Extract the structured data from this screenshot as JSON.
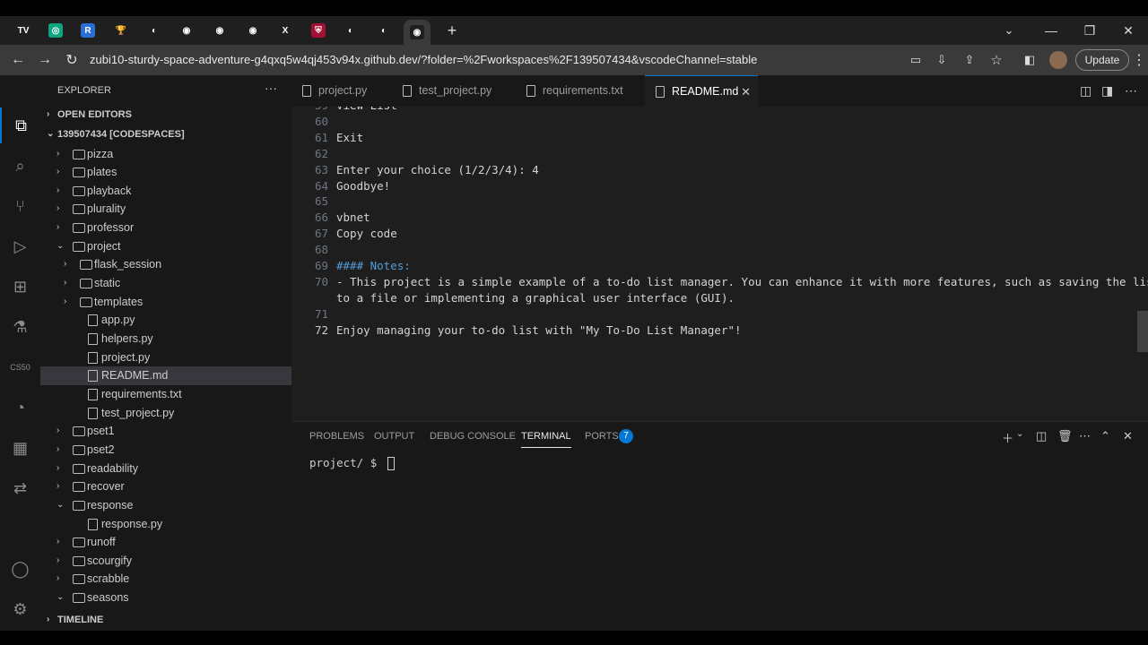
{
  "browser": {
    "url": "zubi10-sturdy-space-adventure-g4qxq5w4qj453v94x.github.dev/?folder=%2Fworkspaces%2F139507434&vscodeChannel=stable",
    "update_label": "Update",
    "new_tab": "+",
    "tabs": [
      {
        "icon": "tv-icon",
        "glyph": "TV",
        "color": "#1f1f1f"
      },
      {
        "icon": "chatgpt-icon",
        "glyph": "◎",
        "color": "#10a37f"
      },
      {
        "icon": "r-icon",
        "glyph": "R",
        "color": "#2a6fd6"
      },
      {
        "icon": "trophy-icon",
        "glyph": "🏆",
        "color": "#1f1f1f"
      },
      {
        "icon": "globe-icon",
        "glyph": "◐",
        "color": "#1f1f1f"
      },
      {
        "icon": "github-icon",
        "glyph": "◉",
        "color": "#1f1f1f"
      },
      {
        "icon": "github-icon",
        "glyph": "◉",
        "color": "#1f1f1f"
      },
      {
        "icon": "github-icon",
        "glyph": "◉",
        "color": "#1f1f1f"
      },
      {
        "icon": "x-icon",
        "glyph": "X",
        "color": "#1f1f1f"
      },
      {
        "icon": "harvard-shield-icon",
        "glyph": "⛨",
        "color": "#a41034"
      },
      {
        "icon": "globe-icon",
        "glyph": "◐",
        "color": "#1f1f1f"
      },
      {
        "icon": "globe-icon",
        "glyph": "◐",
        "color": "#1f1f1f"
      },
      {
        "icon": "github-icon",
        "glyph": "◉",
        "color": "#1f1f1f"
      }
    ]
  },
  "explorer": {
    "title": "EXPLORER",
    "more": "···",
    "open_editors": "OPEN EDITORS",
    "workspace": "139507434 [CODESPACES]",
    "timeline": "TIMELINE",
    "tree": [
      {
        "label": "pizza",
        "type": "folder",
        "depth": 0,
        "open": false
      },
      {
        "label": "plates",
        "type": "folder",
        "depth": 0,
        "open": false
      },
      {
        "label": "playback",
        "type": "folder",
        "depth": 0,
        "open": false
      },
      {
        "label": "plurality",
        "type": "folder",
        "depth": 0,
        "open": false
      },
      {
        "label": "professor",
        "type": "folder",
        "depth": 0,
        "open": false
      },
      {
        "label": "project",
        "type": "folder",
        "depth": 0,
        "open": true
      },
      {
        "label": "flask_session",
        "type": "folder",
        "depth": 1,
        "open": false
      },
      {
        "label": "static",
        "type": "folder",
        "depth": 1,
        "open": false
      },
      {
        "label": "templates",
        "type": "folder",
        "depth": 1,
        "open": false
      },
      {
        "label": "app.py",
        "type": "file",
        "depth": 1
      },
      {
        "label": "helpers.py",
        "type": "file",
        "depth": 1
      },
      {
        "label": "project.py",
        "type": "file",
        "depth": 1
      },
      {
        "label": "README.md",
        "type": "file",
        "depth": 1,
        "selected": true
      },
      {
        "label": "requirements.txt",
        "type": "file",
        "depth": 1
      },
      {
        "label": "test_project.py",
        "type": "file",
        "depth": 1
      },
      {
        "label": "pset1",
        "type": "folder",
        "depth": 0,
        "open": false
      },
      {
        "label": "pset2",
        "type": "folder",
        "depth": 0,
        "open": false
      },
      {
        "label": "readability",
        "type": "folder",
        "depth": 0,
        "open": false
      },
      {
        "label": "recover",
        "type": "folder",
        "depth": 0,
        "open": false
      },
      {
        "label": "response",
        "type": "folder",
        "depth": 0,
        "open": true
      },
      {
        "label": "response.py",
        "type": "file",
        "depth": 1
      },
      {
        "label": "runoff",
        "type": "folder",
        "depth": 0,
        "open": false
      },
      {
        "label": "scourgify",
        "type": "folder",
        "depth": 0,
        "open": false
      },
      {
        "label": "scrabble",
        "type": "folder",
        "depth": 0,
        "open": false
      },
      {
        "label": "seasons",
        "type": "folder",
        "depth": 0,
        "open": true
      }
    ]
  },
  "activity_bar": {
    "cs50_label": "CS50",
    "items": [
      "files-icon",
      "search-icon",
      "source-control-icon",
      "run-debug-icon",
      "extensions-icon",
      "testing-icon",
      "cs50-icon",
      "duck-icon",
      "docker-icon",
      "remote-icon"
    ],
    "bottom": [
      "account-icon",
      "settings-gear-icon"
    ]
  },
  "editor": {
    "tabs": [
      {
        "label": "project.py",
        "active": false
      },
      {
        "label": "test_project.py",
        "active": false
      },
      {
        "label": "requirements.txt",
        "active": false
      },
      {
        "label": "README.md",
        "active": true
      }
    ],
    "close_glyph": "✕",
    "lines": [
      {
        "n": "59",
        "text": "View List",
        "heading": false
      },
      {
        "n": "60",
        "text": "",
        "heading": false
      },
      {
        "n": "61",
        "text": "Exit",
        "heading": false
      },
      {
        "n": "62",
        "text": "",
        "heading": false
      },
      {
        "n": "63",
        "text": "Enter your choice (1/2/3/4): 4",
        "heading": false
      },
      {
        "n": "64",
        "text": "Goodbye!",
        "heading": false
      },
      {
        "n": "65",
        "text": "",
        "heading": false
      },
      {
        "n": "66",
        "text": "vbnet",
        "heading": false
      },
      {
        "n": "67",
        "text": "Copy code",
        "heading": false
      },
      {
        "n": "68",
        "text": "",
        "heading": false
      },
      {
        "n": "69",
        "text": "#### Notes:",
        "heading": true
      },
      {
        "n": "70",
        "text": "- This project is a simple example of a to-do list manager. You can enhance it with more features, such as saving the list",
        "heading": false
      },
      {
        "n": "",
        "text": "to a file or implementing a graphical user interface (GUI).",
        "heading": false
      },
      {
        "n": "71",
        "text": "",
        "heading": false
      },
      {
        "n": "72",
        "text": "Enjoy managing your to-do list with \"My To-Do List Manager\"!",
        "heading": false,
        "current": true
      }
    ]
  },
  "panel": {
    "tabs": [
      "PROBLEMS",
      "OUTPUT",
      "DEBUG CONSOLE",
      "TERMINAL",
      "PORTS"
    ],
    "active_tab": "TERMINAL",
    "ports_badge": "7",
    "prompt": "project/ $ "
  }
}
